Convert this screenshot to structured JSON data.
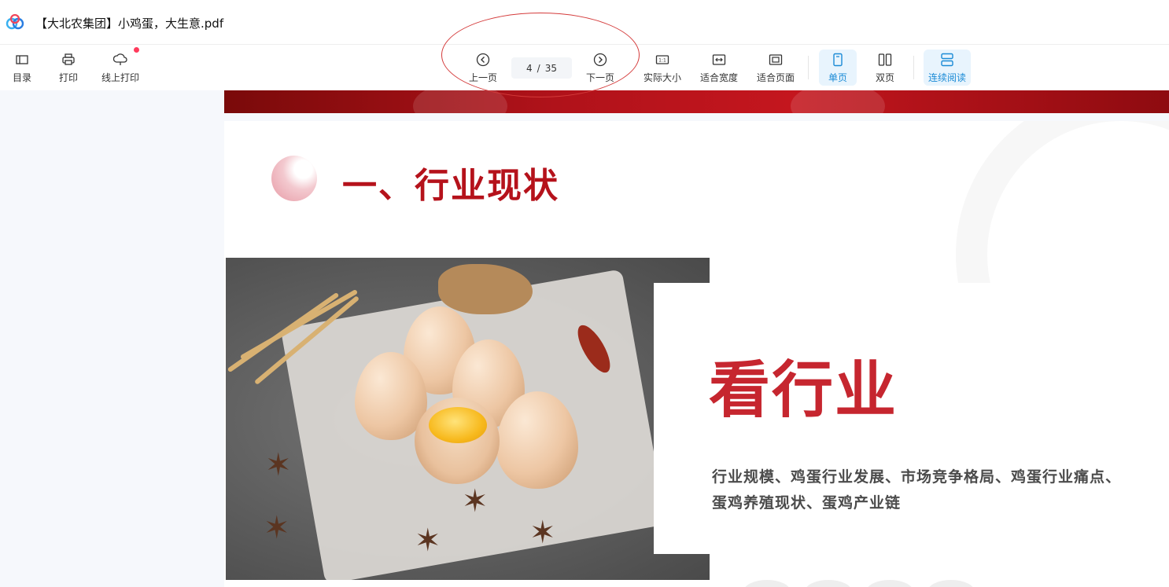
{
  "window": {
    "title": "【大北农集团】小鸡蛋，大生意.pdf"
  },
  "toolbar": {
    "left": [
      {
        "label": "目录",
        "icon": "toc-icon"
      },
      {
        "label": "打印",
        "icon": "printer-icon"
      },
      {
        "label": "线上打印",
        "icon": "cloud-print-icon",
        "badge": "red-dot"
      }
    ],
    "prev_label": "上一页",
    "next_label": "下一页",
    "page_current": "4",
    "page_sep": "/",
    "page_total": "35",
    "view_tools": [
      {
        "label": "实际大小",
        "icon": "actual-size-icon"
      },
      {
        "label": "适合宽度",
        "icon": "fit-width-icon"
      },
      {
        "label": "适合页面",
        "icon": "fit-page-icon"
      }
    ],
    "layout_tools": [
      {
        "label": "单页",
        "icon": "single-page-icon",
        "active": true
      },
      {
        "label": "双页",
        "icon": "double-page-icon",
        "active": false
      },
      {
        "label": "连续阅读",
        "icon": "continuous-read-icon",
        "active": true
      }
    ]
  },
  "document": {
    "section_title": "一、行业现状",
    "card_title": "看行业",
    "card_lines": [
      "行业规模、鸡蛋行业发展、市场竞争格局、鸡蛋行业痛点、",
      "蛋鸡养殖现状、蛋鸡产业链"
    ]
  },
  "colors": {
    "accent": "#1b8bd6",
    "brand_red": "#b5121b",
    "annotation": "#d43a3a"
  }
}
